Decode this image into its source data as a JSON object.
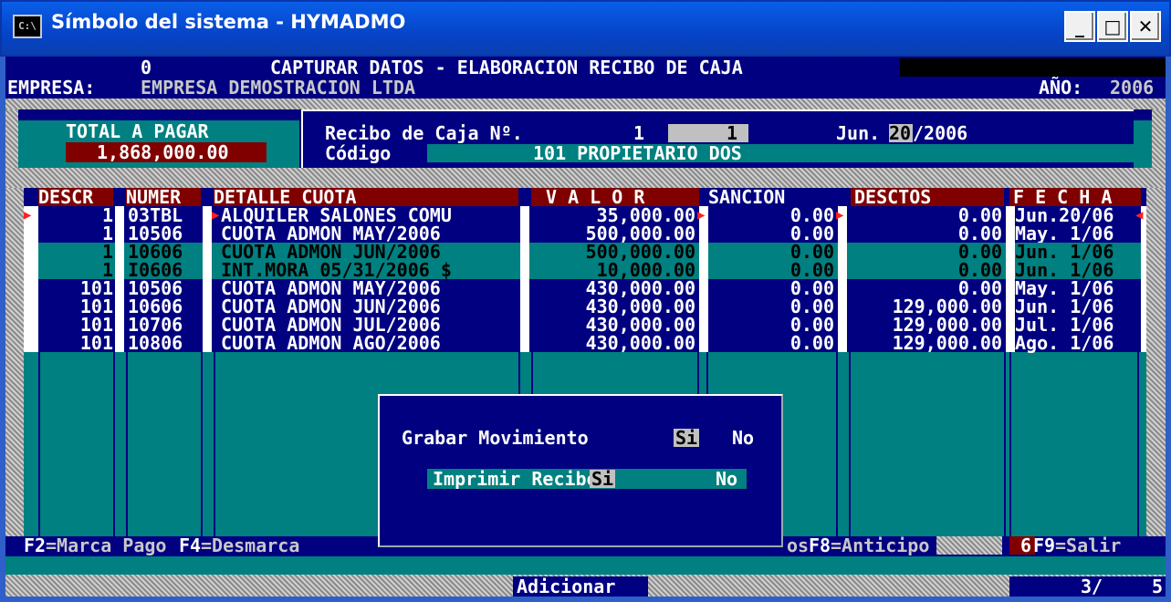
{
  "window": {
    "title": "Símbolo del sistema - HYMADMO",
    "icon_text": "C:\\",
    "controls": [
      "minimize",
      "maximize",
      "close"
    ]
  },
  "header": {
    "counter": "0",
    "screen_title": "CAPTURAR DATOS - ELABORACION RECIBO DE CAJA",
    "empresa_label": "EMPRESA:",
    "empresa_value": "EMPRESA DEMOSTRACION LTDA",
    "anio_label": "AÑO:",
    "anio_value": "2006"
  },
  "total": {
    "label": "TOTAL A PAGAR",
    "value": "1,868,000.00"
  },
  "recibo": {
    "label": "Recibo de Caja Nº.",
    "num1": "1",
    "num2": "1",
    "date_prefix": "Jun.",
    "date_day": "20",
    "date_suffix": "/2006",
    "codigo_label": "Código",
    "codigo_value": "101 PROPIETARIO DOS"
  },
  "table": {
    "columns": [
      "DESCR",
      "NUMER",
      "DETALLE CUOTA",
      "V A L O R",
      "SANCION",
      "DESCTOS",
      "F E C H A"
    ],
    "rows": [
      {
        "descr": "1",
        "numer": "03TBL",
        "detalle": "ALQUILER SALONES COMU",
        "valor": "35,000.00",
        "sancion": "0.00",
        "desctos": "0.00",
        "fecha": "Jun.20/06"
      },
      {
        "descr": "1",
        "numer": "10506",
        "detalle": "CUOTA ADMON MAY/2006",
        "valor": "500,000.00",
        "sancion": "0.00",
        "desctos": "0.00",
        "fecha": "May. 1/06"
      },
      {
        "descr": "1",
        "numer": "10606",
        "detalle": "CUOTA ADMON JUN/2006",
        "valor": "500,000.00",
        "sancion": "0.00",
        "desctos": "0.00",
        "fecha": "Jun. 1/06"
      },
      {
        "descr": "1",
        "numer": "I0606",
        "detalle": "INT.MORA 05/31/2006 $",
        "valor": "10,000.00",
        "sancion": "0.00",
        "desctos": "0.00",
        "fecha": "Jun. 1/06"
      },
      {
        "descr": "101",
        "numer": "10506",
        "detalle": "CUOTA ADMON MAY/2006",
        "valor": "430,000.00",
        "sancion": "0.00",
        "desctos": "0.00",
        "fecha": "May. 1/06"
      },
      {
        "descr": "101",
        "numer": "10606",
        "detalle": "CUOTA ADMON JUN/2006",
        "valor": "430,000.00",
        "sancion": "0.00",
        "desctos": "129,000.00",
        "fecha": "Jun. 1/06"
      },
      {
        "descr": "101",
        "numer": "10706",
        "detalle": "CUOTA ADMON JUL/2006",
        "valor": "430,000.00",
        "sancion": "0.00",
        "desctos": "129,000.00",
        "fecha": "Jul. 1/06"
      },
      {
        "descr": "101",
        "numer": "10806",
        "detalle": "CUOTA ADMON AGO/2006",
        "valor": "430,000.00",
        "sancion": "0.00",
        "desctos": "129,000.00",
        "fecha": "Ago. 1/06"
      }
    ]
  },
  "dialog": {
    "grabar_label": "Grabar Movimiento",
    "grabar_si": "Si",
    "grabar_no": "No",
    "imprimir_label": "Imprimir Recibo",
    "imprimir_si": "Si",
    "imprimir_no": "No"
  },
  "fkeys": {
    "f2_key": "F2",
    "f2_label": "=Marca Pago",
    "f4_key": "F4",
    "f4_label": "=Desmarca",
    "f8_prefix": "os",
    "f8_key": "F8",
    "f8_label": "=Anticipo",
    "f9_prefix": "6",
    "f9_key": "F9",
    "f9_label": "=Salir"
  },
  "status": {
    "mode": "Adicionar",
    "page_current": "3/",
    "page_total": "5"
  },
  "colors": {
    "console_bg": "#000080",
    "teal": "#008080",
    "maroon": "#800000",
    "highlight_gray": "#c0c0c0"
  }
}
